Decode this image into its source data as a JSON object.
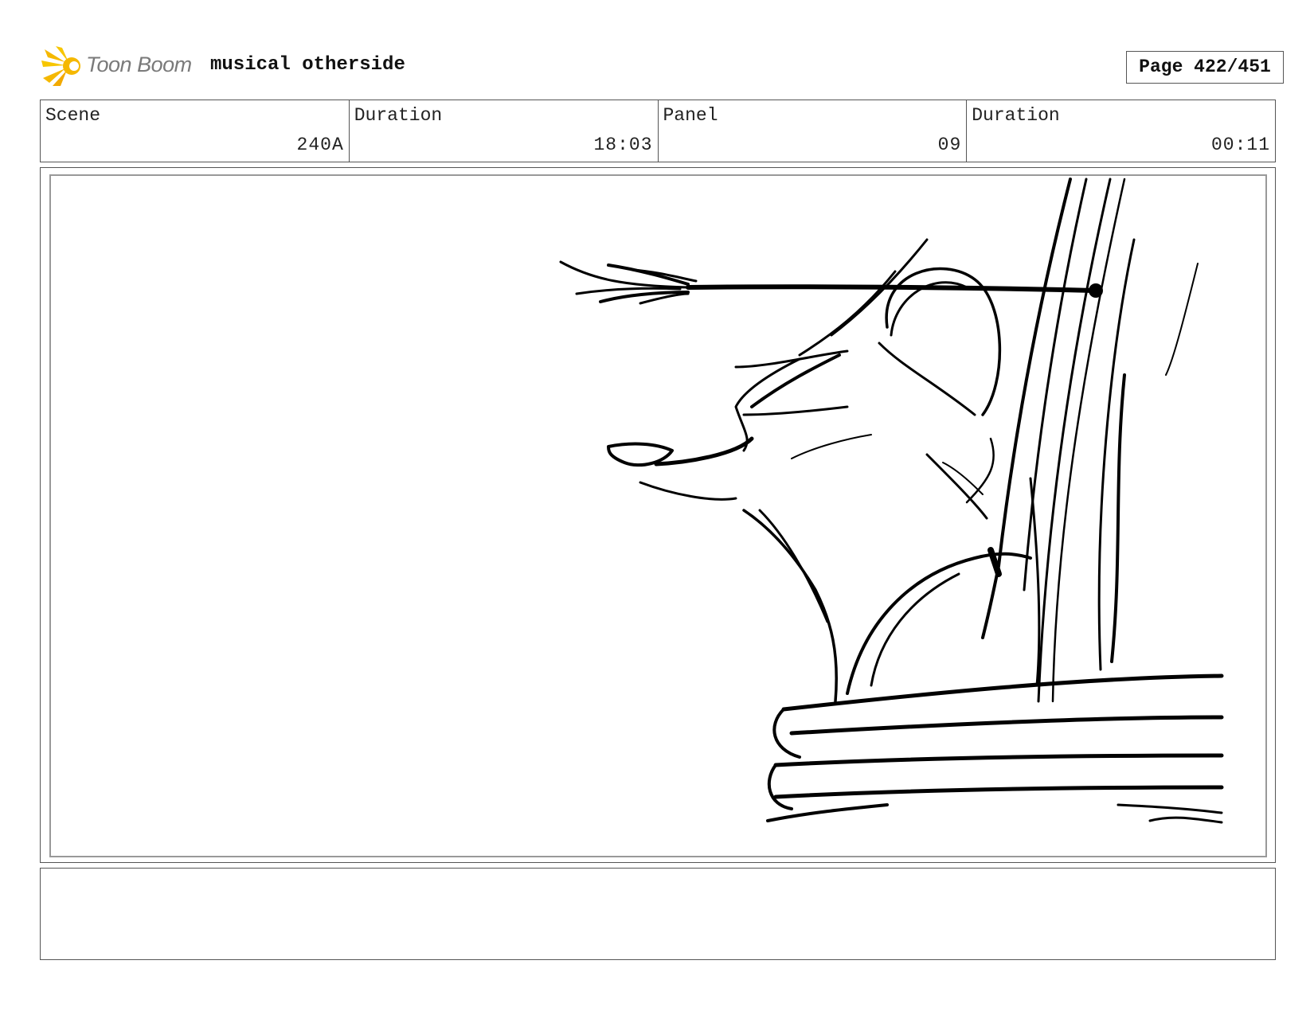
{
  "header": {
    "logo_text": "Toon Boom",
    "project_title": "musical otherside",
    "page_label": "Page 422/451"
  },
  "info": {
    "scene": {
      "label": "Scene",
      "value": "240A"
    },
    "scene_duration": {
      "label": "Duration",
      "value": "18:03"
    },
    "panel": {
      "label": "Panel",
      "value": "09"
    },
    "panel_duration": {
      "label": "Duration",
      "value": "00:11"
    }
  },
  "colors": {
    "logo_accent": "#f5b800",
    "border": "#555555",
    "sketch_ink": "#000000"
  },
  "panel": {
    "drawing": "storyboard sketch"
  },
  "notes": {
    "text": ""
  }
}
